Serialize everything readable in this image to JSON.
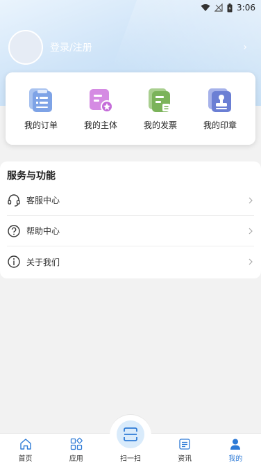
{
  "status_bar": {
    "time": "3:06",
    "icons": [
      "wifi-icon",
      "signal-icon",
      "battery-icon"
    ]
  },
  "profile": {
    "login_label": "登录/注册"
  },
  "quick_actions": [
    {
      "label": "我的订单",
      "icon": "order-icon",
      "color": "#7ea3e6"
    },
    {
      "label": "我的主体",
      "icon": "entity-icon",
      "color": "#c46ad8"
    },
    {
      "label": "我的发票",
      "icon": "invoice-icon",
      "color": "#7bb35a"
    },
    {
      "label": "我的印章",
      "icon": "seal-icon",
      "color": "#6b7fd4"
    }
  ],
  "services": {
    "title": "服务与功能",
    "items": [
      {
        "label": "客服中心",
        "icon": "headset-icon"
      },
      {
        "label": "帮助中心",
        "icon": "question-icon"
      },
      {
        "label": "关于我们",
        "icon": "info-icon"
      }
    ]
  },
  "tabbar": {
    "home": "首页",
    "apps": "应用",
    "scan": "扫一扫",
    "news": "资讯",
    "mine": "我的",
    "active": "我的",
    "accent": "#2d7ad6"
  }
}
